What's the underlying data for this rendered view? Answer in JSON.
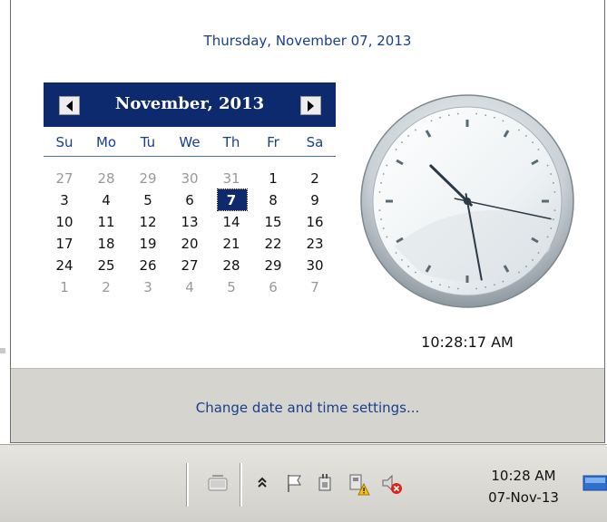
{
  "popup": {
    "long_date": "Thursday, November 07, 2013",
    "calendar": {
      "month_title": "November, 2013",
      "weekdays": [
        "Su",
        "Mo",
        "Tu",
        "We",
        "Th",
        "Fr",
        "Sa"
      ],
      "days": [
        [
          "27",
          "28",
          "29",
          "30",
          "31",
          "1",
          "2"
        ],
        [
          "3",
          "4",
          "5",
          "6",
          "7",
          "8",
          "9"
        ],
        [
          "10",
          "11",
          "12",
          "13",
          "14",
          "15",
          "16"
        ],
        [
          "17",
          "18",
          "19",
          "20",
          "21",
          "22",
          "23"
        ],
        [
          "24",
          "25",
          "26",
          "27",
          "28",
          "29",
          "30"
        ],
        [
          "1",
          "2",
          "3",
          "4",
          "5",
          "6",
          "7"
        ]
      ],
      "selected": "7"
    },
    "clock": {
      "hours": 10,
      "minutes": 28,
      "seconds": 17
    },
    "time_text": "10:28:17 AM",
    "change_link": "Change date and time settings..."
  },
  "taskbar": {
    "tray_time": "10:28 AM",
    "tray_date": "07-Nov-13",
    "icons": [
      "keyboard-icon",
      "show-hidden-icons-chevron",
      "action-center-flag-icon",
      "power-plug-icon",
      "network-warning-icon",
      "volume-muted-icon",
      "desktop-icon"
    ]
  },
  "colors": {
    "accent_navy": "#0e2a6e",
    "link_blue": "#1a3f8a",
    "footer_bg": "#d6d4ce"
  }
}
